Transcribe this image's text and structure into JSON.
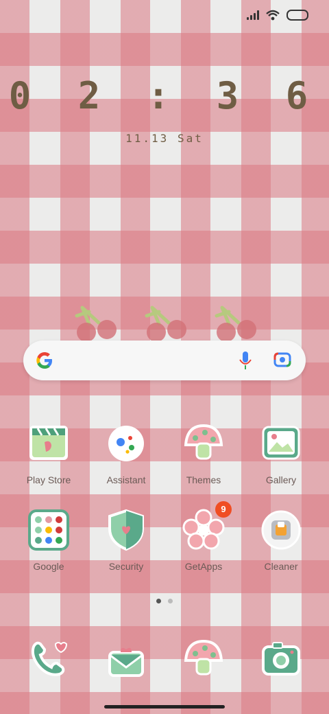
{
  "clock": {
    "time": "0 2 : 3 6",
    "date": "11.13 Sat"
  },
  "search": {
    "mic_icon": "microphone-icon",
    "lens_icon": "lens-icon"
  },
  "apps_row1": [
    {
      "label": "Play Store",
      "icon": "play-store-icon"
    },
    {
      "label": "Assistant",
      "icon": "assistant-icon"
    },
    {
      "label": "Themes",
      "icon": "mushroom-icon"
    },
    {
      "label": "Gallery",
      "icon": "gallery-icon"
    }
  ],
  "apps_row2": [
    {
      "label": "Google",
      "icon": "folder-icon"
    },
    {
      "label": "Security",
      "icon": "shield-icon"
    },
    {
      "label": "GetApps",
      "icon": "flower-icon",
      "badge": "9"
    },
    {
      "label": "Cleaner",
      "icon": "cleaner-icon"
    }
  ],
  "dock": [
    {
      "icon": "phone-icon"
    },
    {
      "icon": "message-icon"
    },
    {
      "icon": "mushroom-icon"
    },
    {
      "icon": "camera-icon"
    }
  ],
  "colors": {
    "accent_pink": "#e39aa3",
    "mint": "#8fcfa9",
    "badge": "#f04e23"
  }
}
